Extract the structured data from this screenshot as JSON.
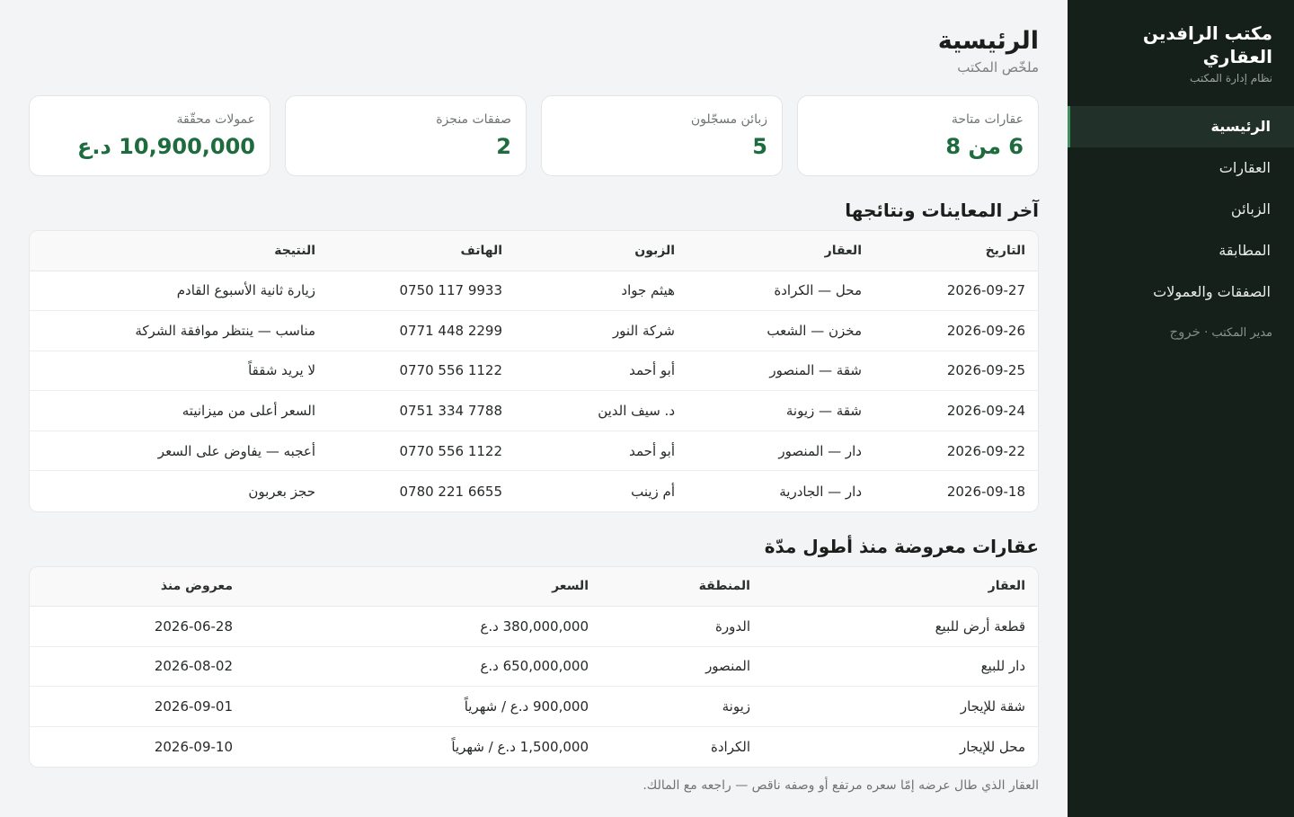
{
  "sidebar": {
    "brand_name": "مكتب الرافدين العقاري",
    "brand_sub": "نظام إدارة المكتب",
    "items": [
      {
        "label": "الرئيسية"
      },
      {
        "label": "العقارات"
      },
      {
        "label": "الزبائن"
      },
      {
        "label": "المطابقة"
      },
      {
        "label": "الصفقات والعمولات"
      }
    ],
    "user_label": "مدير المكتب ·",
    "logout_label": "خروج"
  },
  "page": {
    "title": "الرئيسية",
    "subtitle": "ملخّص المكتب"
  },
  "stats": [
    {
      "label": "عقارات متاحة",
      "value": "6 من 8"
    },
    {
      "label": "زبائن مسجّلون",
      "value": "5"
    },
    {
      "label": "صفقات منجزة",
      "value": "2"
    },
    {
      "label": "عمولات محقّقة",
      "value": "10,900,000 د.ع"
    }
  ],
  "viewings": {
    "title": "آخر المعاينات ونتائجها",
    "headers": [
      "التاريخ",
      "العقار",
      "الزبون",
      "الهاتف",
      "النتيجة"
    ],
    "rows": [
      [
        "2026-09-27",
        "محل — الكرادة",
        "هيثم جواد",
        "0750 117 9933",
        "زيارة ثانية الأسبوع القادم"
      ],
      [
        "2026-09-26",
        "مخزن — الشعب",
        "شركة النور",
        "0771 448 2299",
        "مناسب — ينتظر موافقة الشركة"
      ],
      [
        "2026-09-25",
        "شقة — المنصور",
        "أبو أحمد",
        "0770 556 1122",
        "لا يريد شققاً"
      ],
      [
        "2026-09-24",
        "شقة — زيونة",
        "د. سيف الدين",
        "0751 334 7788",
        "السعر أعلى من ميزانيته"
      ],
      [
        "2026-09-22",
        "دار — المنصور",
        "أبو أحمد",
        "0770 556 1122",
        "أعجبه — يفاوض على السعر"
      ],
      [
        "2026-09-18",
        "دار — الجادرية",
        "أم زينب",
        "0780 221 6655",
        "حجز بعربون"
      ]
    ]
  },
  "listings": {
    "title": "عقارات معروضة منذ أطول مدّة",
    "headers": [
      "العقار",
      "المنطقة",
      "السعر",
      "معروض منذ"
    ],
    "rows": [
      [
        "قطعة أرض للبيع",
        "الدورة",
        "380,000,000 د.ع",
        "2026-06-28"
      ],
      [
        "دار للبيع",
        "المنصور",
        "650,000,000 د.ع",
        "2026-08-02"
      ],
      [
        "شقة للإيجار",
        "زيونة",
        "900,000 د.ع / شهرياً",
        "2026-09-01"
      ],
      [
        "محل للإيجار",
        "الكرادة",
        "1,500,000 د.ع / شهرياً",
        "2026-09-10"
      ]
    ],
    "note": "العقار الذي طال عرضه إمّا سعره مرتفع أو وصفه ناقص — راجعه مع المالك."
  },
  "colors": {
    "sidebar_bg": "#16201b",
    "accent_green": "#1e6b3e",
    "page_bg": "#f3f4f6"
  }
}
